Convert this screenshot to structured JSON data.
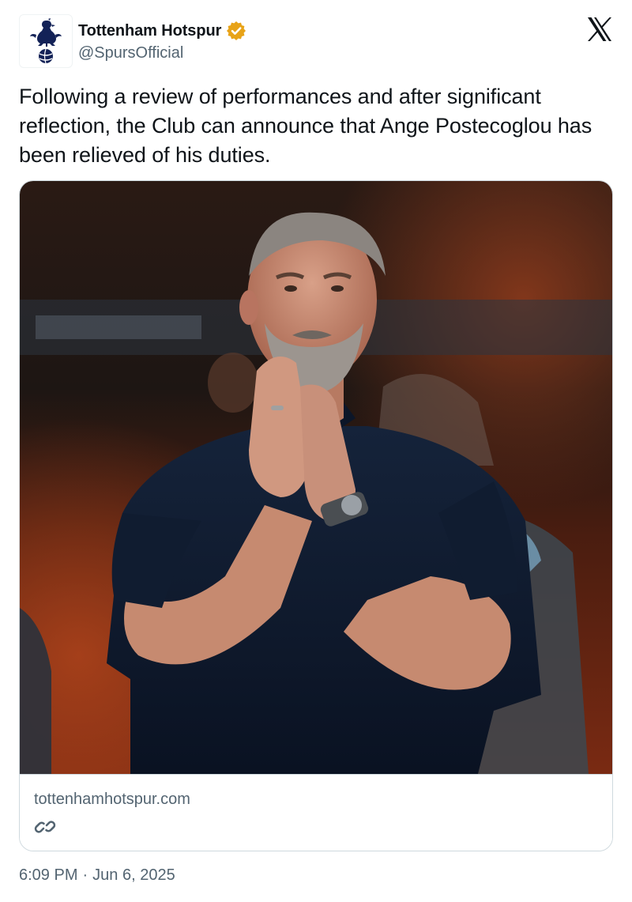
{
  "author": {
    "display_name": "Tottenham Hotspur",
    "handle": "@SpursOfficial",
    "verified": true,
    "verified_color": "#e8a317",
    "avatar_icon": "cockerel-crest-icon"
  },
  "platform_logo": "x-logo-icon",
  "tweet": {
    "text": "Following a review of performances and after significant reflection, the Club can announce that Ange Postecoglou has been relieved of his duties."
  },
  "link_card": {
    "image_icon": "manager-applauding-photo",
    "domain": "tottenhamhotspur.com",
    "link_icon": "link-icon"
  },
  "meta": {
    "time": "6:09 PM",
    "separator": "·",
    "date": "Jun 6, 2025"
  },
  "colors": {
    "text_primary": "#0f1419",
    "text_secondary": "#536471",
    "border": "#cfd9de",
    "spurs_navy": "#132257"
  }
}
